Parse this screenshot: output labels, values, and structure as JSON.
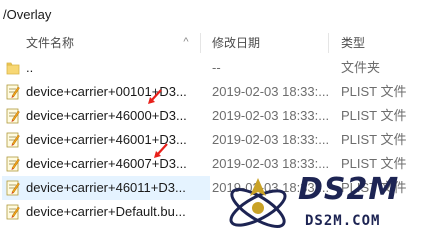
{
  "path": "/Overlay",
  "columns": {
    "name": "文件名称",
    "date": "修改日期",
    "type": "类型"
  },
  "rows": [
    {
      "icon": "folder-icon",
      "name": "..",
      "date": "--",
      "type": "文件夹"
    },
    {
      "icon": "plist-file-icon",
      "name": "device+carrier+00101+D3...",
      "date": "2019-02-03 18:33:...",
      "type": "PLIST 文件"
    },
    {
      "icon": "plist-file-icon",
      "name": "device+carrier+46000+D3...",
      "date": "2019-02-03 18:33:...",
      "type": "PLIST 文件"
    },
    {
      "icon": "plist-file-icon",
      "name": "device+carrier+46001+D3...",
      "date": "2019-02-03 18:33:...",
      "type": "PLIST 文件"
    },
    {
      "icon": "plist-file-icon",
      "name": "device+carrier+46007+D3...",
      "date": "2019-02-03 18:33:...",
      "type": "PLIST 文件"
    },
    {
      "icon": "plist-file-icon",
      "name": "device+carrier+46011+D3...",
      "date": "2019-02-03 18:33:...",
      "type": "PLIST 文件",
      "selected": true
    },
    {
      "icon": "plist-file-icon",
      "name": "device+carrier+Default.bu...",
      "date": "",
      "type": ""
    }
  ],
  "watermark": {
    "title": "DS2M",
    "subtitle": "DS2M.COM"
  },
  "colors": {
    "selection": "#e5f3ff",
    "folder": "#f7d774",
    "annotation_arrow": "#e8201a",
    "watermark": "#1d2453",
    "watermark_accent": "#c9a227"
  }
}
